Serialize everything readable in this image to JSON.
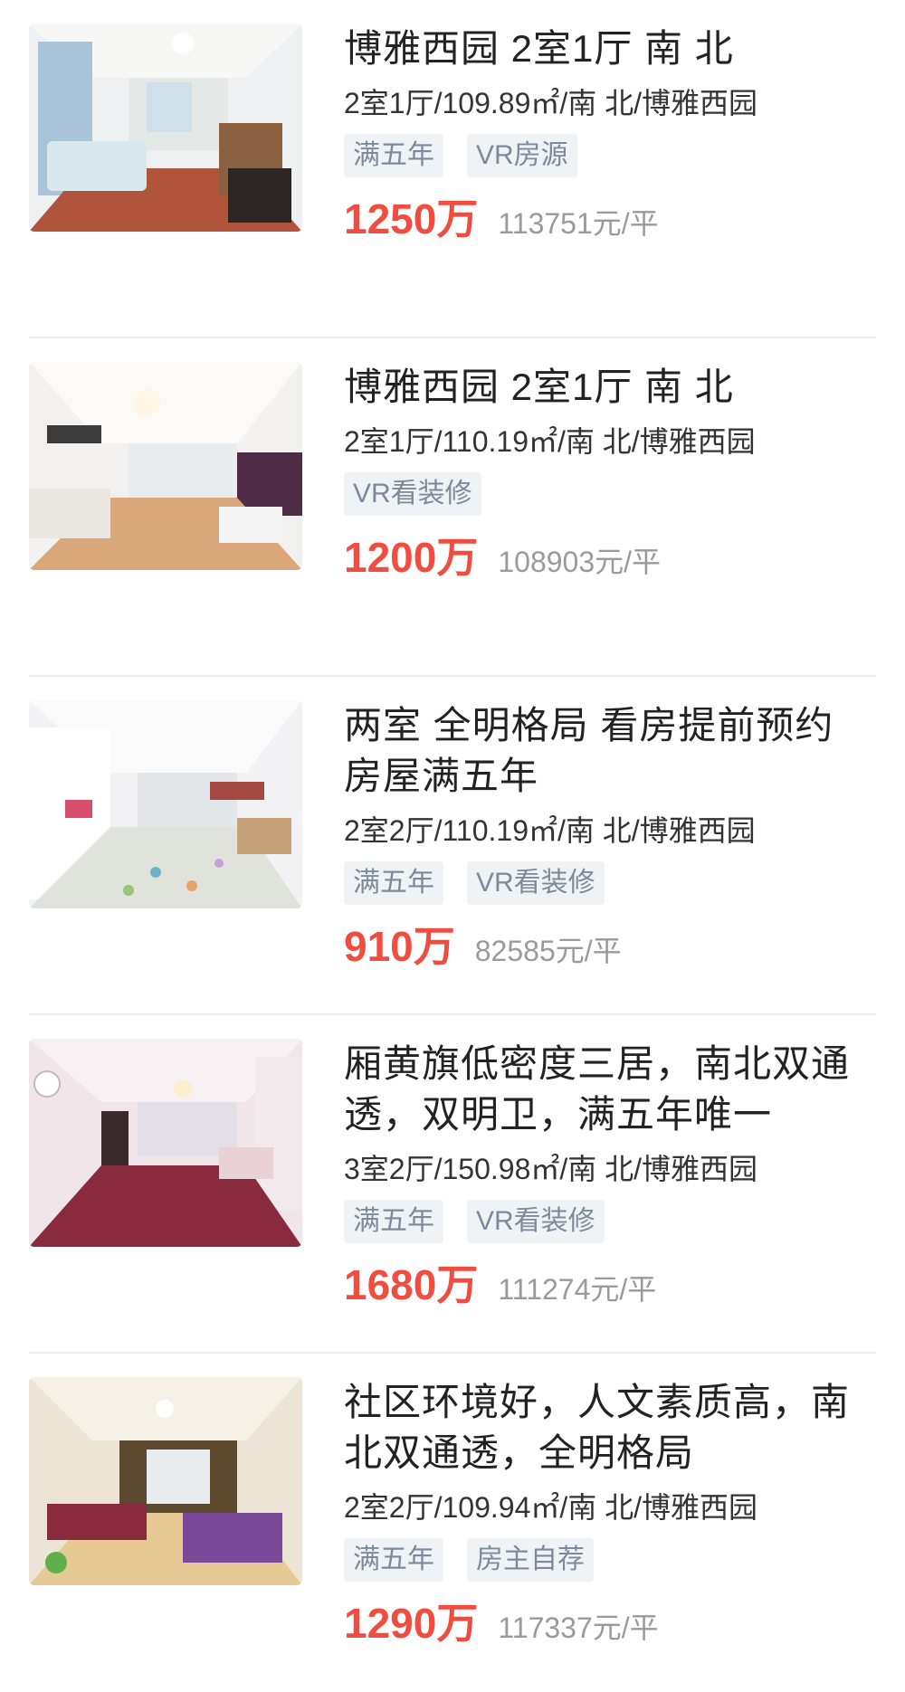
{
  "listings": [
    {
      "title": "博雅西园 2室1厅 南 北",
      "desc": "2室1厅/109.89㎡/南 北/博雅西园",
      "tags": [
        "满五年",
        "VR房源"
      ],
      "price": "1250万",
      "unit_price": "113751元/平",
      "photo": "living-room-blue-wall"
    },
    {
      "title": "博雅西园 2室1厅 南 北",
      "desc": "2室1厅/110.19㎡/南 北/博雅西园",
      "tags": [
        "VR看装修"
      ],
      "price": "1200万",
      "unit_price": "108903元/平",
      "photo": "living-room-wood-floor"
    },
    {
      "title": "两室 全明格局 看房提前预约 房屋满五年",
      "desc": "2室2厅/110.19㎡/南 北/博雅西园",
      "tags": [
        "满五年",
        "VR看装修"
      ],
      "price": "910万",
      "unit_price": "82585元/平",
      "photo": "living-room-play-mat"
    },
    {
      "title": "厢黄旗低密度三居，南北双通透，双明卫，满五年唯一",
      "desc": "3室2厅/150.98㎡/南 北/博雅西园",
      "tags": [
        "满五年",
        "VR看装修"
      ],
      "price": "1680万",
      "unit_price": "111274元/平",
      "photo": "living-room-red-floor"
    },
    {
      "title": "社区环境好，人文素质高，南北双通透，全明格局",
      "desc": "2室2厅/109.94㎡/南 北/博雅西园",
      "tags": [
        "满五年",
        "房主自荐"
      ],
      "price": "1290万",
      "unit_price": "117337元/平",
      "photo": "living-room-tiled-floor"
    }
  ]
}
